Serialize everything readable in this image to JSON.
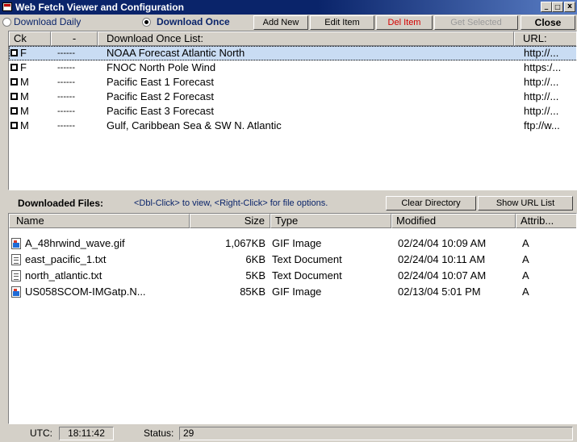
{
  "window": {
    "title": "Web Fetch Viewer and Configuration",
    "btn_min": "_",
    "btn_max": "□",
    "btn_close": "x"
  },
  "toolbar": {
    "radio_daily": "Download Daily",
    "radio_once": "Download Once",
    "add_new": "Add New",
    "edit_item": "Edit Item",
    "del_item": "Del Item",
    "get_selected": "Get Selected",
    "close": "Close"
  },
  "once_list": {
    "headers": {
      "ck": "Ck",
      "dash": "-",
      "name": "Download Once List:",
      "url": "URL:"
    },
    "rows": [
      {
        "ck": "F",
        "dash": "------",
        "name": "NOAA Forecast Atlantic North",
        "url": "http://..."
      },
      {
        "ck": "F",
        "dash": "------",
        "name": "FNOC North Pole Wind",
        "url": "https:/..."
      },
      {
        "ck": "M",
        "dash": "------",
        "name": "Pacific East 1 Forecast",
        "url": "http://..."
      },
      {
        "ck": "M",
        "dash": "------",
        "name": "Pacific East 2 Forecast",
        "url": "http://..."
      },
      {
        "ck": "M",
        "dash": "------",
        "name": "Pacific East 3 Forecast",
        "url": "http://..."
      },
      {
        "ck": "M",
        "dash": "------",
        "name": "Gulf, Caribbean Sea & SW N. Atlantic",
        "url": "ftp://w..."
      }
    ]
  },
  "downloads": {
    "label": "Downloaded Files:",
    "hint": "<Dbl-Click> to view, <Right-Click> for file options.",
    "clear_dir": "Clear Directory",
    "show_url": "Show URL List",
    "headers": {
      "name": "Name",
      "size": "Size",
      "type": "Type",
      "modified": "Modified",
      "attrib": "Attrib..."
    },
    "files": [
      {
        "icon": "gif-image-icon",
        "name": "A_48hrwind_wave.gif",
        "size": "1,067KB",
        "type": "GIF Image",
        "modified": "02/24/04 10:09 AM",
        "attrib": "A"
      },
      {
        "icon": "text-document-icon",
        "name": "east_pacific_1.txt",
        "size": "6KB",
        "type": "Text Document",
        "modified": "02/24/04 10:11 AM",
        "attrib": "A"
      },
      {
        "icon": "text-document-icon",
        "name": "north_atlantic.txt",
        "size": "5KB",
        "type": "Text Document",
        "modified": "02/24/04 10:07 AM",
        "attrib": "A"
      },
      {
        "icon": "gif-image-icon",
        "name": "US058SCOM-IMGatp.N...",
        "size": "85KB",
        "type": "GIF Image",
        "modified": "02/13/04 5:01 PM",
        "attrib": "A"
      }
    ]
  },
  "status": {
    "utc_label": "UTC:",
    "utc_value": "18:11:42",
    "status_label": "Status:",
    "status_value": "29"
  }
}
